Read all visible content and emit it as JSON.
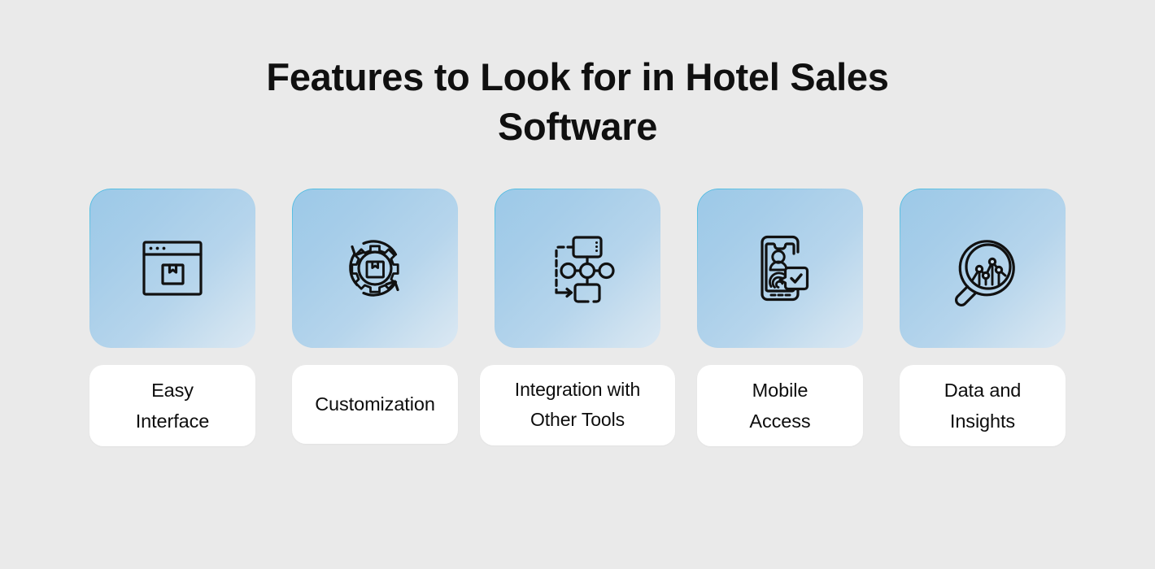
{
  "page": {
    "background_color": "#eaeaea",
    "title": "Features to Look for in Hotel Sales Software"
  },
  "theme": {
    "tile_gradient_start": "#9cc9e8",
    "tile_gradient_end": "#dbe8f3",
    "tile_rim_accent": "#3fb8e0",
    "label_card_background": "#ffffff",
    "text_color": "#111111",
    "icon_stroke_color": "#111111"
  },
  "features": [
    {
      "id": "easy-interface",
      "label": "Easy Interface",
      "label_line_1": "Easy",
      "label_line_2": "Interface",
      "icon_name": "browser-window-box-icon"
    },
    {
      "id": "customization",
      "label": "Customization",
      "label_line_1": "Customization",
      "label_line_2": "",
      "icon_name": "gear-refresh-box-icon"
    },
    {
      "id": "integration-with-other-tools",
      "label": "Integration with Other Tools",
      "label_line_1": "Integration with",
      "label_line_2": "Other Tools",
      "icon_name": "network-flowchart-icon"
    },
    {
      "id": "mobile-access",
      "label": "Mobile Access",
      "label_line_1": "Mobile",
      "label_line_2": "Access",
      "icon_name": "mobile-fingerprint-verified-icon"
    },
    {
      "id": "data-and-insights",
      "label": "Data and Insights",
      "label_line_1": "Data and",
      "label_line_2": "Insights",
      "icon_name": "magnifier-analytics-chart-icon"
    }
  ]
}
